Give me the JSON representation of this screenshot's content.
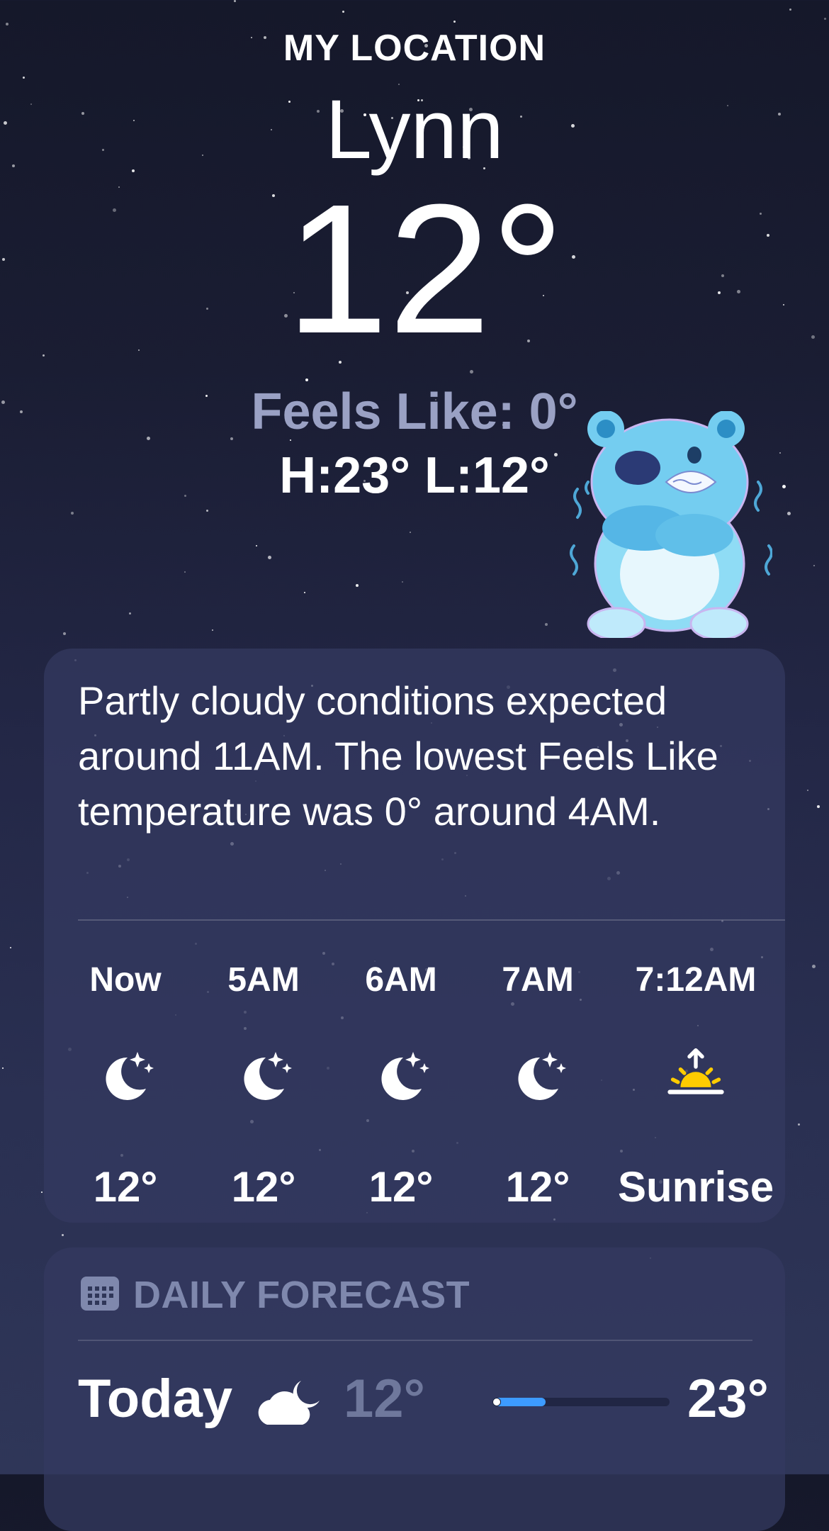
{
  "header": {
    "location_label": "MY LOCATION",
    "city": "Lynn",
    "temperature": "12°",
    "feels_like": "Feels Like: 0°",
    "high": "H:23°",
    "low": "L:12°"
  },
  "summary_card": {
    "text": "Partly cloudy conditions expected around 11AM. The lowest Feels Like temperature was 0° around 4AM.",
    "hourly": [
      {
        "time": "Now",
        "icon": "moon-stars-icon",
        "value": "12°"
      },
      {
        "time": "5AM",
        "icon": "moon-stars-icon",
        "value": "12°"
      },
      {
        "time": "6AM",
        "icon": "moon-stars-icon",
        "value": "12°"
      },
      {
        "time": "7AM",
        "icon": "moon-stars-icon",
        "value": "12°"
      },
      {
        "time": "7:12AM",
        "icon": "sunrise-icon",
        "value": "Sunrise"
      }
    ]
  },
  "daily_forecast": {
    "title": "DAILY FORECAST",
    "rows": [
      {
        "day": "Today",
        "icon": "partly-cloudy-night-icon",
        "low": "12°",
        "high": "23°",
        "current_range_fraction": 0.3
      }
    ]
  },
  "colors": {
    "accent_blue": "#3d9bff",
    "sunrise_yellow": "#ffcc00",
    "muted_text": "#9aa1c4"
  }
}
